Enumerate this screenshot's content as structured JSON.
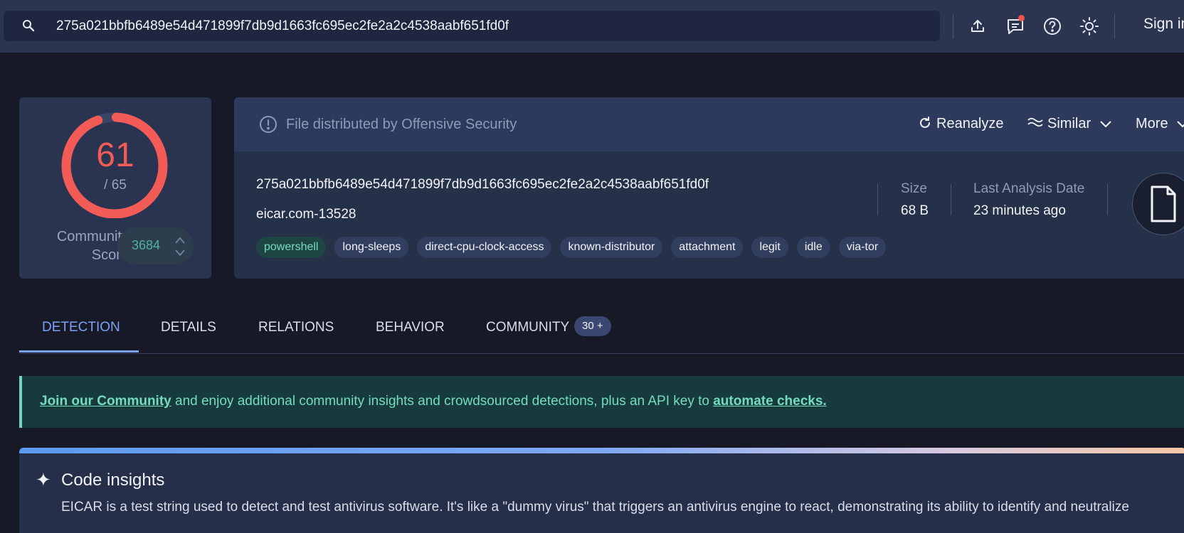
{
  "search": {
    "value": "275a021bbfb6489e54d471899f7db9d1663fc695ec2fe2a2c4538aabf651fd0f"
  },
  "topbar": {
    "sign_in": "Sign in"
  },
  "score": {
    "detections": "61",
    "total": "/ 65",
    "detection_fraction": 0.9385,
    "color": "#f25b56",
    "community_label_1": "Community",
    "community_label_2": "Score",
    "community_value": "3684"
  },
  "file": {
    "distributed_by": "File distributed by Offensive Security",
    "hash": "275a021bbfb6489e54d471899f7db9d1663fc695ec2fe2a2c4538aabf651fd0f",
    "name": "eicar.com-13528",
    "size_label": "Size",
    "size_value": "68 B",
    "date_label": "Last Analysis Date",
    "date_value": "23 minutes ago",
    "tags": [
      "powershell",
      "long-sleeps",
      "direct-cpu-clock-access",
      "known-distributor",
      "attachment",
      "legit",
      "idle",
      "via-tor"
    ]
  },
  "actions": {
    "reanalyze": "Reanalyze",
    "similar": "Similar",
    "more": "More"
  },
  "tabs": [
    {
      "label": "DETECTION"
    },
    {
      "label": "DETAILS"
    },
    {
      "label": "RELATIONS"
    },
    {
      "label": "BEHAVIOR"
    },
    {
      "label": "COMMUNITY"
    }
  ],
  "community_badge": "30 +",
  "banner": {
    "link1": "Join our Community",
    "middle": " and enjoy additional community insights and crowdsourced detections, plus an API key to ",
    "link2": "automate checks."
  },
  "insights": {
    "title": "Code insights",
    "text": "EICAR is a test string used to detect and test antivirus software. It's like a \"dummy virus\" that triggers an antivirus engine to react, demonstrating its ability to identify and neutralize"
  }
}
